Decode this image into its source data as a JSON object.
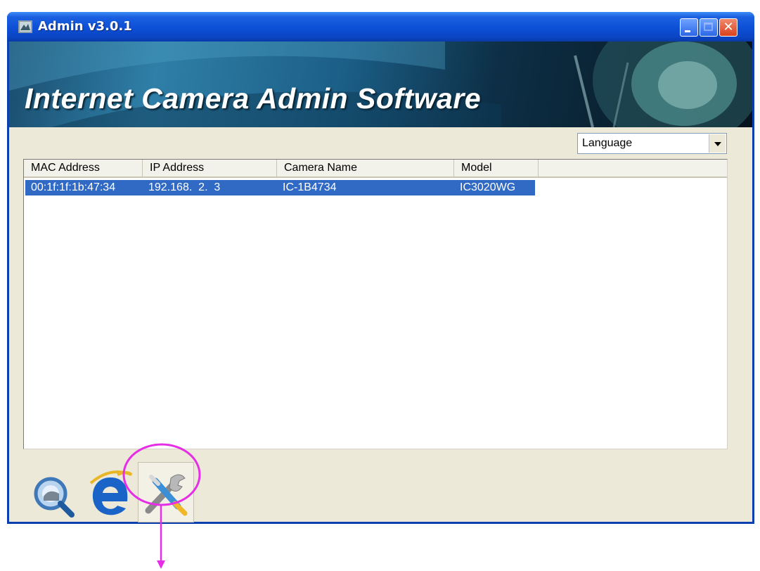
{
  "window": {
    "title": "Admin v3.0.1"
  },
  "banner": {
    "title": "Internet Camera Admin Software"
  },
  "language": {
    "selected": "Language"
  },
  "table": {
    "columns": [
      "MAC Address",
      "IP Address",
      "Camera Name",
      "Model"
    ],
    "rows": [
      {
        "mac": "00:1f:1f:1b:47:34",
        "ip": "192.168.  2.  3",
        "name": "IC-1B4734",
        "model": "IC3020WG",
        "selected": true
      }
    ]
  },
  "toolbar": {
    "icons": [
      "search-camera-icon",
      "internet-explorer-icon",
      "settings-tools-icon"
    ]
  },
  "colors": {
    "titlebar": "#0d4fd6",
    "selection": "#316ac5",
    "annotation": "#e62ee6"
  }
}
